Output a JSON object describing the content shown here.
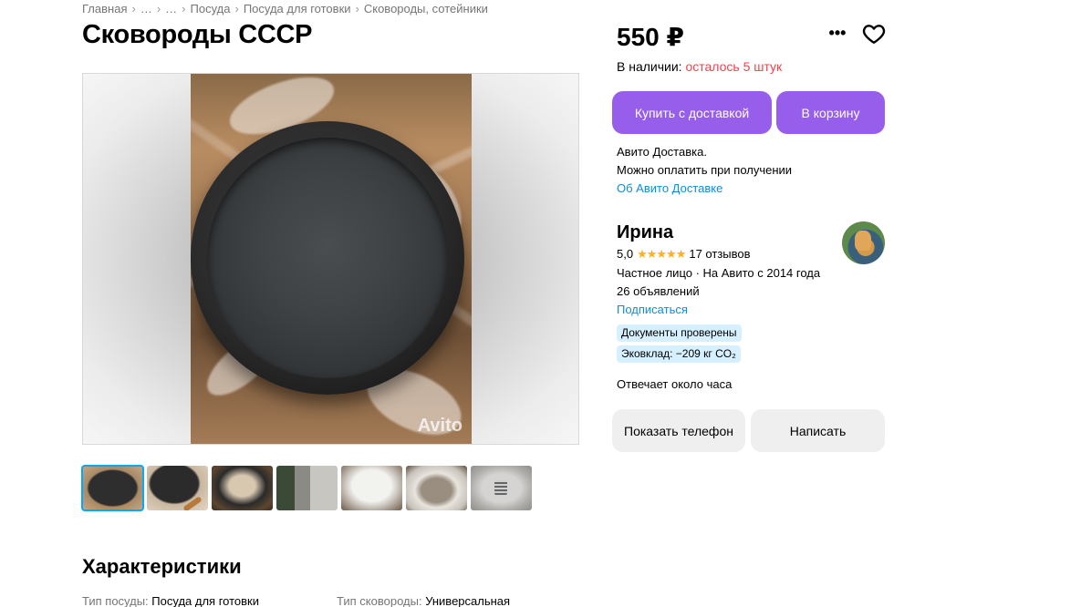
{
  "breadcrumbs": {
    "home": "Главная",
    "ellipsis1": "…",
    "ellipsis2": "…",
    "cat1": "Посуда",
    "cat2": "Посуда для готовки",
    "cat3": "Сковороды, сотейники",
    "separator": "›"
  },
  "title": "Сковороды СССР",
  "gallery": {
    "watermark": "Avito",
    "thumb_count": 7
  },
  "characteristics": {
    "heading": "Характеристики",
    "items": [
      {
        "key": "Тип посуды:",
        "value": "Посуда для готовки"
      },
      {
        "key": "Тип сковороды:",
        "value": "Универсальная"
      }
    ]
  },
  "price": "550 ₽",
  "actions": {
    "more_icon": "more-horizontal-icon",
    "fav_icon": "heart-icon"
  },
  "stock": {
    "label": "В наличии:",
    "left": "осталось 5 штук"
  },
  "buttons": {
    "buy_delivery": "Купить с доставкой",
    "to_cart": "В корзину",
    "show_phone": "Показать телефон",
    "write": "Написать"
  },
  "delivery": {
    "line1": "Авито Доставка.",
    "line2": "Можно оплатить при получении",
    "link": "Об Авито Доставке"
  },
  "seller": {
    "name": "Ирина",
    "rating": "5,0",
    "stars": "★★★★★",
    "reviews": "17 отзывов",
    "type_since": "Частное лицо · На Авито с 2014 года",
    "ads": "26 объявлений",
    "subscribe": "Подписаться",
    "badge1": "Документы проверены",
    "badge2": "Эковклад: −209 кг CO₂",
    "response": "Отвечает около часа"
  },
  "colors": {
    "accent": "#965eeb",
    "link": "#0a8ee0",
    "stock_red": "#f2424a",
    "star": "#ffb021",
    "badge_bg": "#d6f0ff"
  }
}
